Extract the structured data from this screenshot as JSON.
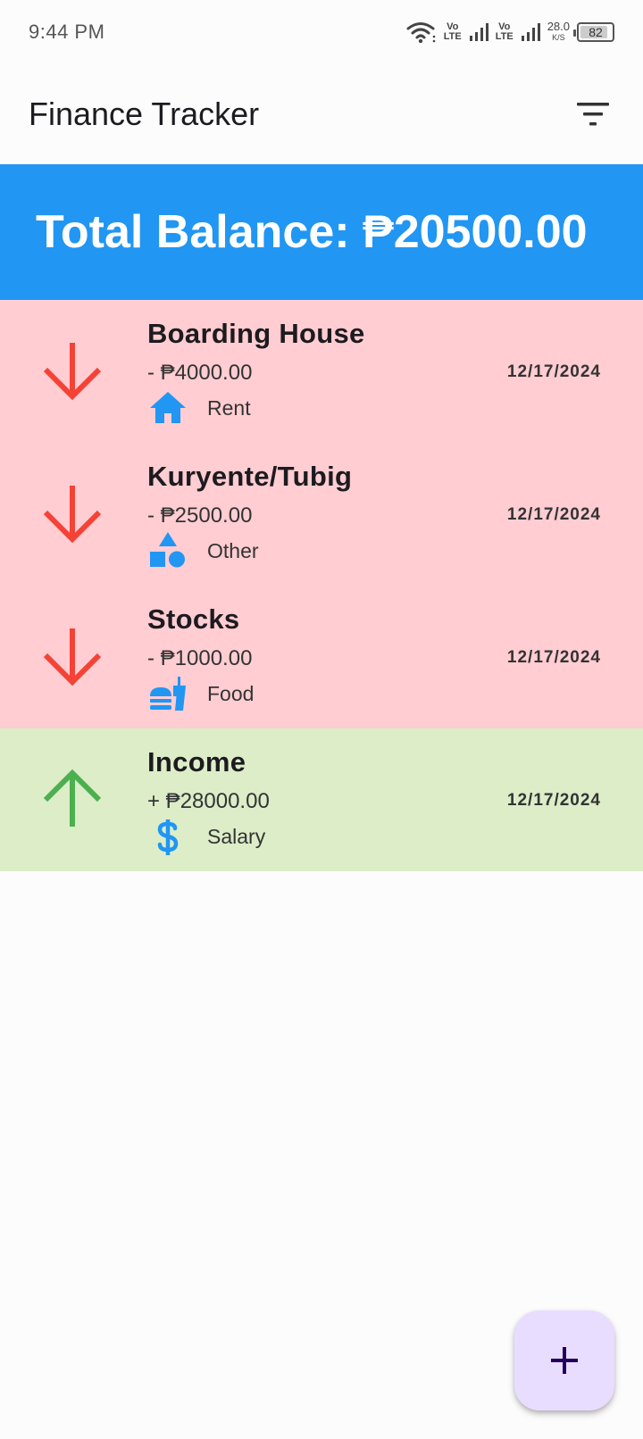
{
  "status_bar": {
    "time": "9:44 PM",
    "net1_top": "Vo",
    "net1_bottom": "LTE",
    "net2_top": "Vo",
    "net2_bottom": "LTE",
    "speed_value": "28.0",
    "speed_unit": "K/S",
    "battery": "82",
    "icons": [
      "wifi-icon",
      "signal-icon",
      "signal-icon",
      "battery-icon"
    ]
  },
  "app_bar": {
    "title": "Finance Tracker",
    "filter_icon": "filter-icon"
  },
  "balance": {
    "label": "Total Balance: ₱20500.00"
  },
  "transactions": [
    {
      "type": "expense",
      "title": "Boarding House",
      "amount": "- ₱4000.00",
      "date": "12/17/2024",
      "category": "Rent",
      "category_icon": "home-icon",
      "arrow_icon": "arrow-down-icon"
    },
    {
      "type": "expense",
      "title": "Kuryente/Tubig",
      "amount": "- ₱2500.00",
      "date": "12/17/2024",
      "category": "Other",
      "category_icon": "shapes-icon",
      "arrow_icon": "arrow-down-icon"
    },
    {
      "type": "expense",
      "title": "Stocks",
      "amount": "- ₱1000.00",
      "date": "12/17/2024",
      "category": "Food",
      "category_icon": "fastfood-icon",
      "arrow_icon": "arrow-down-icon"
    },
    {
      "type": "income",
      "title": "Income",
      "amount": "+ ₱28000.00",
      "date": "12/17/2024",
      "category": "Salary",
      "category_icon": "dollar-icon",
      "arrow_icon": "arrow-up-icon"
    }
  ],
  "fab": {
    "icon": "add-icon"
  },
  "colors": {
    "primary_blue": "#2196F3",
    "expense_bg": "#FFCDD2",
    "income_bg": "#DCEDC8",
    "expense_arrow": "#F44336",
    "income_arrow": "#4CAF50",
    "category_icon": "#2196F3",
    "fab_bg": "#E9DDFF"
  }
}
